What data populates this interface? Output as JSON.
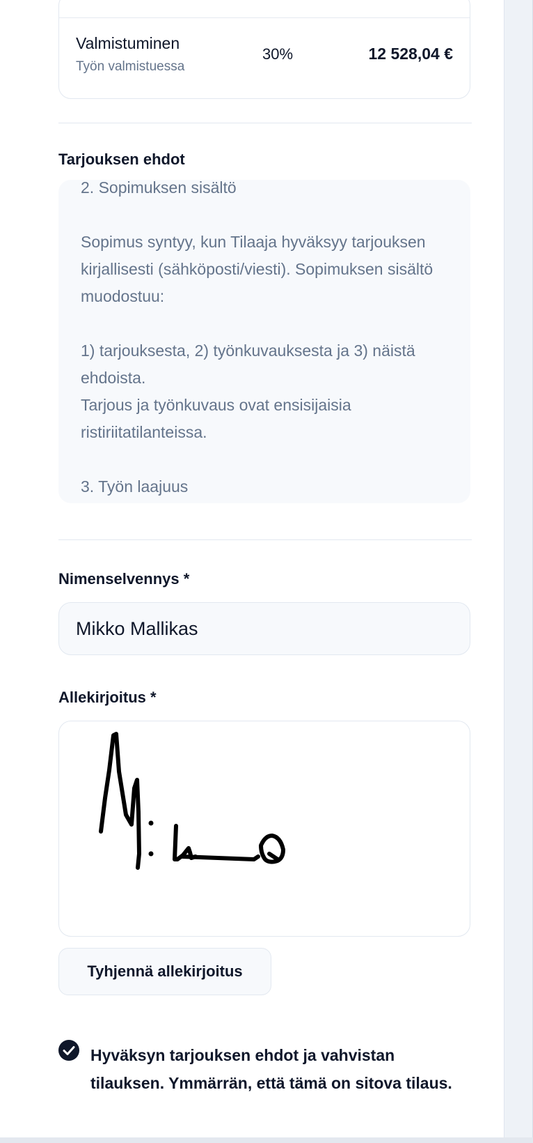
{
  "payment": {
    "title": "Valmistuminen",
    "subtitle": "Työn valmistuessa",
    "percent": "30%",
    "amount": "12 528,04 €"
  },
  "terms": {
    "label": "Tarjouksen ehdot",
    "text": "2. Sopimuksen sisältö\n\nSopimus syntyy, kun Tilaaja hyväksyy tarjouksen kirjallisesti (sähköposti/viesti). Sopimuksen sisältö muodostuu:\n\n1) tarjouksesta, 2) työnkuvauksesta ja 3) näistä ehdoista.\nTarjous ja työnkuvaus ovat ensisijaisia ristiriitatilanteissa.\n\n3. Työn laajuus"
  },
  "name_field": {
    "label": "Nimenselvennys *",
    "value": "Mikko Mallikas"
  },
  "signature": {
    "label": "Allekirjoitus *",
    "clear_label": "Tyhjennä allekirjoitus"
  },
  "acceptance": {
    "checked": true,
    "label": "Hyväksyn tarjouksen ehdot ja vahvistan tilauksen. Ymmärrän, että tämä on sitova tilaus."
  }
}
